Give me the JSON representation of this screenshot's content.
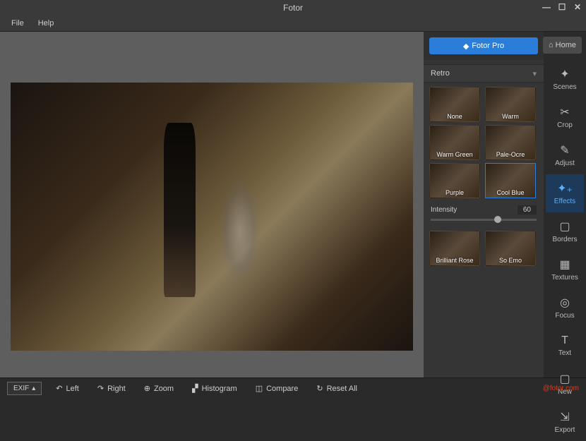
{
  "app": {
    "title": "Fotor"
  },
  "menu": {
    "file": "File",
    "help": "Help"
  },
  "top": {
    "pro": "Fotor Pro",
    "home": "Home"
  },
  "category": "Retro",
  "effects": {
    "group1": [
      {
        "label": "None"
      },
      {
        "label": "Warm"
      },
      {
        "label": "Warm Green"
      },
      {
        "label": "Pale-Ocre"
      },
      {
        "label": "Purple"
      },
      {
        "label": "Cool Blue",
        "selected": true
      }
    ],
    "group2": [
      {
        "label": "Brilliant Rose"
      },
      {
        "label": "So Emo"
      }
    ]
  },
  "intensity": {
    "label": "Intensity",
    "value": "60"
  },
  "tools": [
    {
      "name": "Scenes",
      "icon": "✦"
    },
    {
      "name": "Crop",
      "icon": "✂"
    },
    {
      "name": "Adjust",
      "icon": "✎"
    },
    {
      "name": "Effects",
      "icon": "✦₊",
      "active": true
    },
    {
      "name": "Borders",
      "icon": "▢"
    },
    {
      "name": "Textures",
      "icon": "▦"
    },
    {
      "name": "Focus",
      "icon": "◎"
    },
    {
      "name": "Text",
      "icon": "T"
    }
  ],
  "toolsBottom": [
    {
      "name": "New",
      "icon": "▢"
    },
    {
      "name": "Export",
      "icon": "⇲"
    }
  ],
  "bottom": {
    "exif": "EXIF",
    "left": "Left",
    "right": "Right",
    "zoom": "Zoom",
    "histogram": "Histogram",
    "compare": "Compare",
    "reset": "Reset All"
  },
  "watermark": "@fotor.com"
}
